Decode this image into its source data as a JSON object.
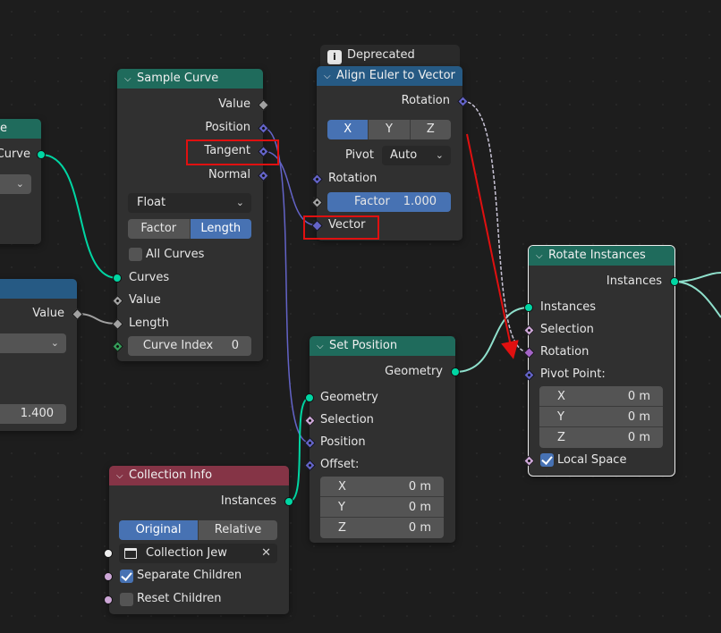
{
  "nodes": {
    "partial_curve": {
      "title": "e",
      "output_curve": "Curve"
    },
    "partial_value": {
      "output_value": "Value",
      "number": "1.400"
    },
    "sample_curve": {
      "title": "Sample Curve",
      "outputs": {
        "value": "Value",
        "position": "Position",
        "tangent": "Tangent",
        "normal": "Normal"
      },
      "data_type": "Float",
      "mode": {
        "factor": "Factor",
        "length": "Length",
        "selected": "Length"
      },
      "all_curves": "All Curves",
      "inputs": {
        "curves": "Curves",
        "value": "Value",
        "length": "Length"
      },
      "curve_index": {
        "label": "Curve Index",
        "value": "0"
      }
    },
    "align_euler": {
      "deprecated_label": "Deprecated",
      "info_glyph": "i",
      "title": "Align Euler to Vector",
      "output_rotation": "Rotation",
      "axis": {
        "x": "X",
        "y": "Y",
        "z": "Z",
        "selected": "X"
      },
      "pivot": {
        "label": "Pivot",
        "value": "Auto"
      },
      "inputs": {
        "rotation": "Rotation",
        "vector": "Vector"
      },
      "factor": {
        "label": "Factor",
        "value": "1.000"
      }
    },
    "set_position": {
      "title": "Set Position",
      "output_geometry": "Geometry",
      "inputs": {
        "geometry": "Geometry",
        "selection": "Selection",
        "position": "Position",
        "offset": "Offset:"
      },
      "offset": [
        {
          "axis": "X",
          "value": "0 m"
        },
        {
          "axis": "Y",
          "value": "0 m"
        },
        {
          "axis": "Z",
          "value": "0 m"
        }
      ]
    },
    "rotate_instances": {
      "title": "Rotate Instances",
      "output_instances": "Instances",
      "inputs": {
        "instances": "Instances",
        "selection": "Selection",
        "rotation": "Rotation",
        "pivot_point": "Pivot Point:"
      },
      "pivot": [
        {
          "axis": "X",
          "value": "0 m"
        },
        {
          "axis": "Y",
          "value": "0 m"
        },
        {
          "axis": "Z",
          "value": "0 m"
        }
      ],
      "local_space": "Local Space"
    },
    "collection_info": {
      "title": "Collection Info",
      "output_instances": "Instances",
      "transform": {
        "original": "Original",
        "relative": "Relative",
        "selected": "Original"
      },
      "collection": "Collection Jew",
      "clear_glyph": "✕",
      "separate_children": "Separate Children",
      "reset_children": "Reset Children"
    }
  },
  "colors": {
    "geometry_socket": "#00d6a3",
    "vector_socket": "#6363c7",
    "float_socket": "#a1a1a1",
    "rotation_socket": "#a364c7",
    "geometry_header": "#1f6b5c",
    "vector_header": "#265a84",
    "input_header": "#853446",
    "selected_button": "#4772b3",
    "annotation_red": "#e01010"
  }
}
